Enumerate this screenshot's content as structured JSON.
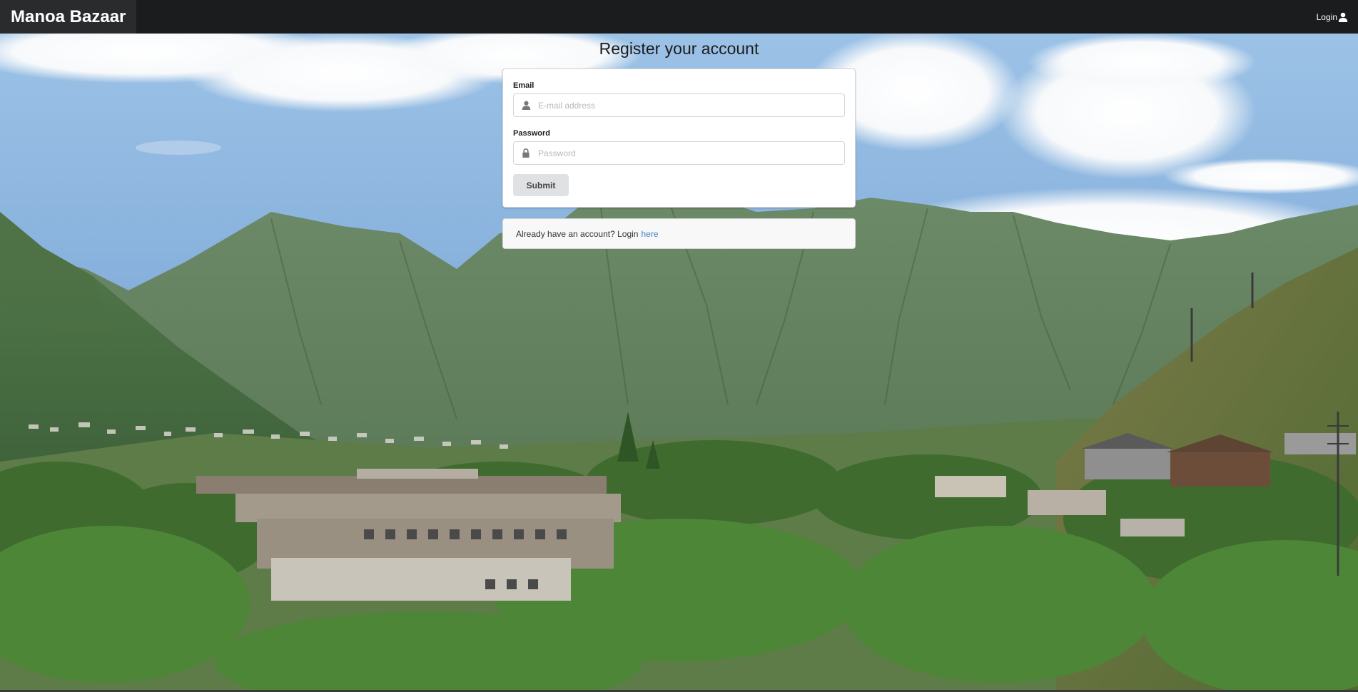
{
  "navbar": {
    "brand": "Manoa Bazaar",
    "login_label": "Login",
    "login_icon": "user-icon",
    "background": "#1b1c1d"
  },
  "form": {
    "title": "Register your account",
    "email": {
      "label": "Email",
      "placeholder": "E-mail address",
      "value": "",
      "icon": "user-icon"
    },
    "password": {
      "label": "Password",
      "placeholder": "Password",
      "value": "",
      "icon": "lock-icon"
    },
    "submit_label": "Submit"
  },
  "message": {
    "text": "Already have an account? Login",
    "link_text": "here",
    "link_color": "#4183c4"
  },
  "background_image": {
    "subject": "mountain-valley-landscape"
  }
}
